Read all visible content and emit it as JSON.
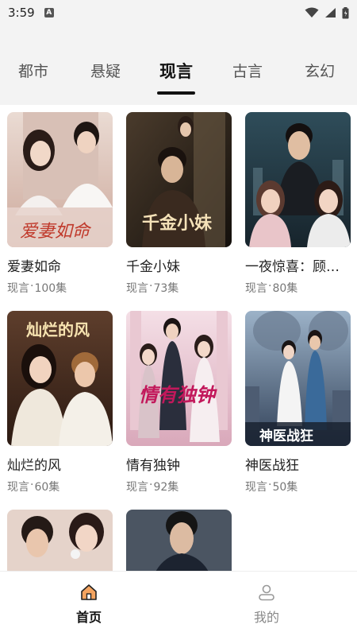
{
  "status_bar": {
    "time": "3:59",
    "notif_letter": "A"
  },
  "tabs": [
    {
      "label": "都市"
    },
    {
      "label": "悬疑"
    },
    {
      "label": "现言"
    },
    {
      "label": "古言"
    },
    {
      "label": "玄幻"
    }
  ],
  "active_tab": "现言",
  "dramas": [
    {
      "title": "爱妻如命",
      "genre": "现言",
      "sep": "·",
      "episodes": "100集",
      "poster_text": "爱妻如命",
      "poster_colors": [
        "#e8d6cf",
        "#c9a79a"
      ]
    },
    {
      "title": "千金小妹",
      "genre": "现言",
      "sep": "·",
      "episodes": "73集",
      "poster_text": "千金小妹",
      "poster_colors": [
        "#3b3026",
        "#1a1410"
      ]
    },
    {
      "title": "一夜惊喜：顾…",
      "genre": "现言",
      "sep": "·",
      "episodes": "80集",
      "poster_text": "",
      "poster_colors": [
        "#2f4a55",
        "#1a2a33"
      ]
    },
    {
      "title": "灿烂的风",
      "genre": "现言",
      "sep": "·",
      "episodes": "60集",
      "poster_text": "灿烂的风",
      "poster_colors": [
        "#6b4a36",
        "#3a2418"
      ]
    },
    {
      "title": "情有独钟",
      "genre": "现言",
      "sep": "·",
      "episodes": "92集",
      "poster_text": "情有独钟",
      "poster_colors": [
        "#f1d6df",
        "#d6a6b8"
      ]
    },
    {
      "title": "神医战狂",
      "genre": "现言",
      "sep": "·",
      "episodes": "50集",
      "poster_text": "神医战狂",
      "poster_colors": [
        "#8aa0b8",
        "#3c4d66"
      ]
    },
    {
      "poster_colors": [
        "#e7d7cf",
        "#b89a8e"
      ]
    },
    {
      "poster_colors": [
        "#55606e",
        "#2b323d"
      ]
    }
  ],
  "bottom_nav": [
    {
      "label": "首页",
      "icon": "home-icon"
    },
    {
      "label": "我的",
      "icon": "profile-icon"
    }
  ],
  "colors": {
    "accent": "#e88a2e",
    "active_text": "#111111",
    "inactive_text": "#888888"
  }
}
